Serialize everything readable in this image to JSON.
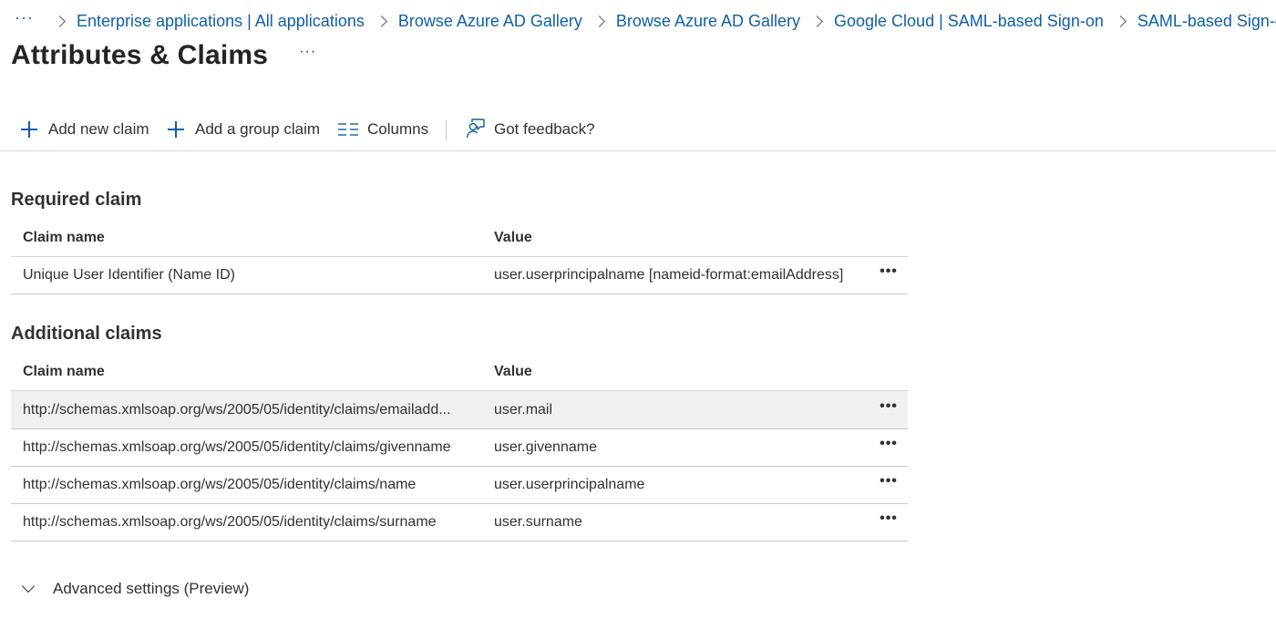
{
  "breadcrumb": {
    "overflow": "···",
    "items": [
      "Enterprise applications | All applications",
      "Browse Azure AD Gallery",
      "Browse Azure AD Gallery",
      "Google Cloud | SAML-based Sign-on",
      "SAML-based Sign-on"
    ]
  },
  "page": {
    "title": "Attributes & Claims",
    "more": "···"
  },
  "toolbar": {
    "add_new_claim": "Add new claim",
    "add_group_claim": "Add a group claim",
    "columns": "Columns",
    "feedback": "Got feedback?"
  },
  "required": {
    "title": "Required claim",
    "headers": {
      "name": "Claim name",
      "value": "Value"
    },
    "rows": [
      {
        "name": "Unique User Identifier (Name ID)",
        "value": "user.userprincipalname [nameid-format:emailAddress]",
        "more": "•••"
      }
    ]
  },
  "additional": {
    "title": "Additional claims",
    "headers": {
      "name": "Claim name",
      "value": "Value"
    },
    "rows": [
      {
        "name": "http://schemas.xmlsoap.org/ws/2005/05/identity/claims/emailadd...",
        "value": "user.mail",
        "more": "•••"
      },
      {
        "name": "http://schemas.xmlsoap.org/ws/2005/05/identity/claims/givenname",
        "value": "user.givenname",
        "more": "•••"
      },
      {
        "name": "http://schemas.xmlsoap.org/ws/2005/05/identity/claims/name",
        "value": "user.userprincipalname",
        "more": "•••"
      },
      {
        "name": "http://schemas.xmlsoap.org/ws/2005/05/identity/claims/surname",
        "value": "user.surname",
        "more": "•••"
      }
    ]
  },
  "advanced": {
    "label": "Advanced settings (Preview)"
  },
  "colors": {
    "link": "#0f5fa8",
    "text": "#323130",
    "selected_row": "#f0f0f0"
  },
  "icons": [
    "chevron-right-icon",
    "plus-icon",
    "columns-icon",
    "feedback-icon",
    "chevron-down-icon",
    "more-icon"
  ]
}
